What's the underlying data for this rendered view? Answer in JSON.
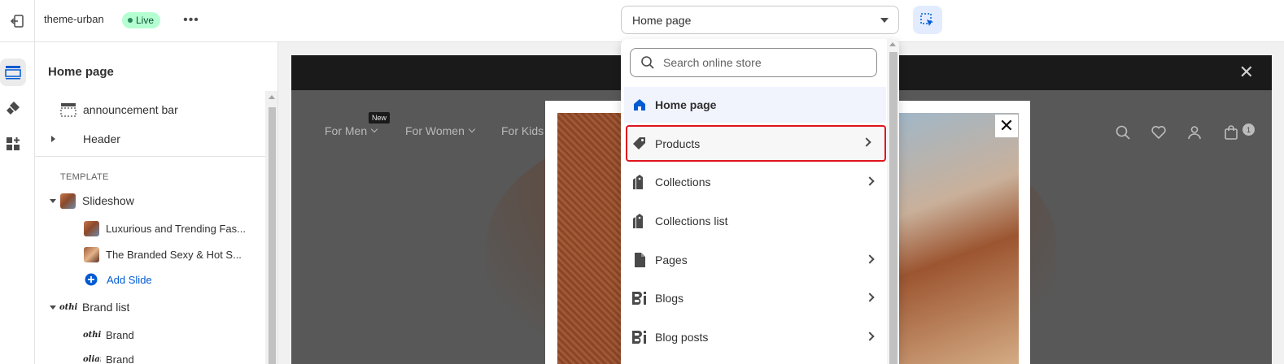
{
  "topbar": {
    "theme_name": "theme-urban",
    "live_label": "Live",
    "more_label": "•••",
    "page_select_value": "Home page"
  },
  "sidebar": {
    "title": "Home page",
    "announcement_bar": "announcement bar",
    "header": "Header",
    "template_label": "TEMPLATE",
    "slideshow": "Slideshow",
    "slides": [
      "Luxurious and Trending Fas...",
      "The Branded Sexy & Hot S..."
    ],
    "add_slide": "Add Slide",
    "brand_list": "Brand list",
    "brands": [
      "Brand",
      "Brand"
    ],
    "brand_thumb_text": "othin",
    "brand_thumb_text2": "oliar"
  },
  "preview": {
    "nav": [
      {
        "label": "For Men"
      },
      {
        "label": "For Women"
      },
      {
        "label": "For Kids"
      }
    ],
    "new_badge": "New",
    "cart_count": "1",
    "close_glyph": "✕",
    "modal_close_glyph": "✕"
  },
  "dropdown": {
    "search_placeholder": "Search online store",
    "items": [
      {
        "label": "Home page",
        "icon": "home-icon"
      },
      {
        "label": "Products",
        "icon": "tag-icon"
      },
      {
        "label": "Collections",
        "icon": "collection-icon"
      },
      {
        "label": "Collections list",
        "icon": "collection-icon"
      },
      {
        "label": "Pages",
        "icon": "page-icon"
      },
      {
        "label": "Blogs",
        "icon": "blog-icon"
      },
      {
        "label": "Blog posts",
        "icon": "blog-icon"
      }
    ]
  },
  "colors": {
    "accent_blue": "#005bd3",
    "live_bg": "#b4fed2",
    "highlight_red": "#e0141e",
    "selected_bg": "#f1f4fd"
  }
}
